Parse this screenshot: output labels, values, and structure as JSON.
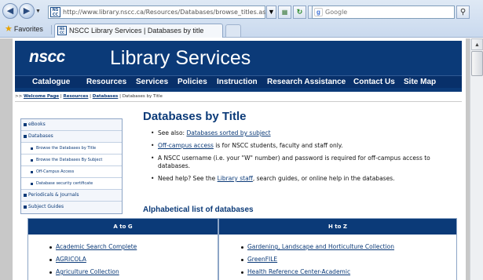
{
  "browser": {
    "url": "http://www.library.nscc.ca/Resources/Databases/browse_titles.asp",
    "search_placeholder": "Google",
    "search_engine_icon": "g-icon",
    "favorites_label": "Favorites",
    "tab_title": "NSCC Library Services | Databases by title",
    "favicon_text": "NS CC"
  },
  "header": {
    "logo": "nscc",
    "title": "Library Services",
    "nav": [
      "Catalogue",
      "Resources",
      "Services",
      "Policies",
      "Instruction",
      "Research Assistance",
      "Contact Us",
      "Site Map"
    ]
  },
  "breadcrumb": {
    "prefix": ">>",
    "items": [
      "Welcome Page",
      "Resources",
      "Databases"
    ],
    "current": "Databases by Title",
    "separator": "|"
  },
  "sidebar": {
    "items": [
      {
        "label": "eBooks",
        "level": "top"
      },
      {
        "label": "Databases",
        "level": "top"
      },
      {
        "label": "Browse the Databases by Title",
        "level": "sub"
      },
      {
        "label": "Browse the Databases By Subject",
        "level": "sub"
      },
      {
        "label": "Off-Campus Access",
        "level": "sub"
      },
      {
        "label": "Database security certificate",
        "level": "sub"
      },
      {
        "label": "Periodicals & Journals",
        "level": "top"
      },
      {
        "label": "Subject Guides",
        "level": "top"
      }
    ]
  },
  "content": {
    "title": "Databases by Title",
    "see_also_prefix": "See also:",
    "see_also_link": "Databases sorted by subject",
    "offcampus_link": "Off-campus access",
    "offcampus_rest": " is for NSCC students, faculty and staff only.",
    "username_text": "A NSCC username (i.e. your \"W\" number) and password is required for off-campus access to databases.",
    "help_prefix": "Need help? See the ",
    "help_link": "Library staff",
    "help_rest": ", search guides, or online help in the databases.",
    "alpha_heading": "Alphabetical list of databases"
  },
  "databases": {
    "col_a_heading": "A to G",
    "col_h_heading": "H to Z",
    "col_a": [
      "Academic Search Complete",
      "AGRICOLA",
      "Agriculture Collection"
    ],
    "col_h": [
      "Gardening, Landscape and Horticulture Collection",
      "GreenFILE",
      "Health Reference Center-Academic"
    ]
  },
  "colors": {
    "brand_blue": "#0b3a78",
    "nav_blue": "#08306a",
    "link_blue": "#0b3a78"
  }
}
